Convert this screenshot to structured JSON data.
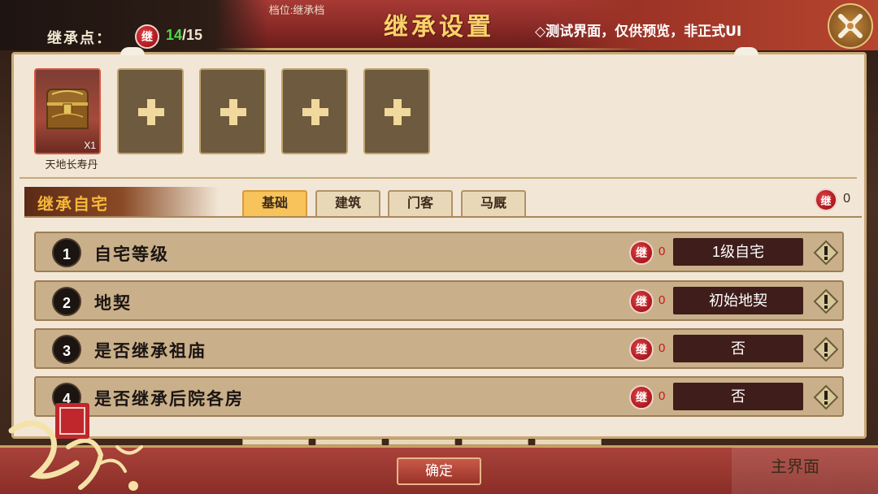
{
  "header": {
    "save_slot": "档位:继承档",
    "inherit_points_label": "继承点：",
    "seal_char": "继",
    "points_current": "14",
    "points_separator": "/",
    "points_max": "15",
    "title": "继承设置",
    "notice": "◇测试界面，仅供预览，非正式UI",
    "close_icon": "close-icon"
  },
  "items": {
    "filled": {
      "name": "天地长寿丹",
      "quantity": "X1",
      "icon": "treasure-chest-icon"
    },
    "empty_slot_icon": "plus-icon",
    "empty_slot_count": 4
  },
  "section": {
    "title": "继承自宅",
    "tabs": [
      "基础",
      "建筑",
      "门客",
      "马厩"
    ],
    "active_tab": 0,
    "seal_char": "继",
    "total_cost": "0"
  },
  "rows": [
    {
      "num": "1",
      "label": "自宅等级",
      "cost": "0",
      "value": "1级自宅"
    },
    {
      "num": "2",
      "label": "地契",
      "cost": "0",
      "value": "初始地契"
    },
    {
      "num": "3",
      "label": "是否继承祖庙",
      "cost": "0",
      "value": "否"
    },
    {
      "num": "4",
      "label": "是否继承后院各房",
      "cost": "0",
      "value": "否"
    }
  ],
  "footer": {
    "confirm_label": "确定",
    "main_menu_label": "主界面"
  },
  "colors": {
    "primary_red": "#8a2a27",
    "gold": "#f8d36a",
    "points_green": "#4ade45",
    "seal_red": "#b21d21",
    "row_value_bg": "#3f1d1a"
  }
}
